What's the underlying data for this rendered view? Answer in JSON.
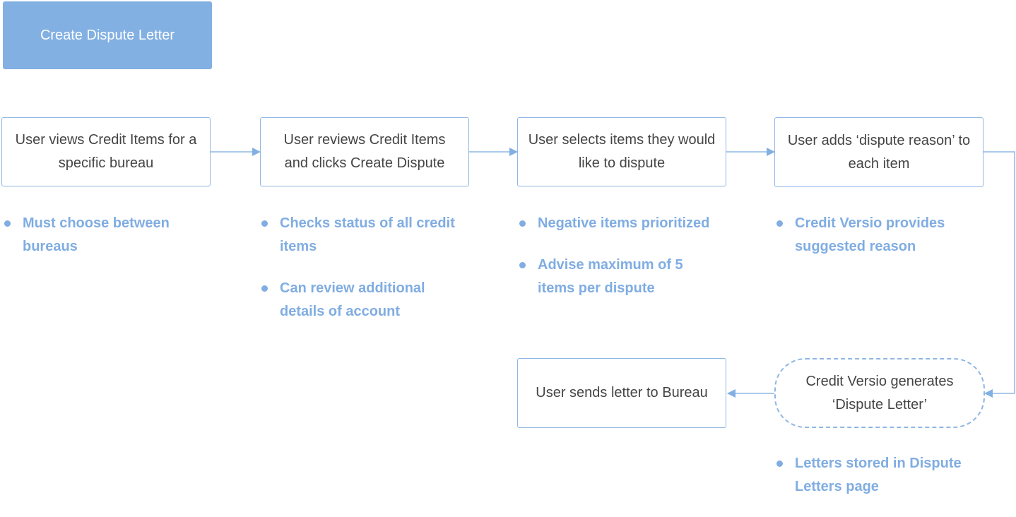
{
  "title": "Create Dispute Letter",
  "steps": [
    {
      "label": "User views Credit Items for a specific bureau",
      "notes": [
        "Must choose between bureaus"
      ]
    },
    {
      "label": "User reviews Credit Items and clicks Create Dispute",
      "notes": [
        "Checks status of all credit items",
        "Can review additional details of account"
      ]
    },
    {
      "label": "User selects items they would like to dispute",
      "notes": [
        "Negative items prioritized",
        "Advise maximum of 5 items per dispute"
      ]
    },
    {
      "label": "User adds ‘dispute reason’ to each item",
      "notes": [
        "Credit Versio provides suggested reason"
      ]
    },
    {
      "label": "Credit Versio generates ‘Dispute Letter’",
      "notes": [
        "Letters stored in Dispute Letters page"
      ]
    },
    {
      "label": "User sends letter to Bureau",
      "notes": []
    }
  ],
  "colors": {
    "accent": "#82b0e2",
    "border": "#8fb7e4",
    "text": "#444444",
    "note": "#80ade2"
  }
}
